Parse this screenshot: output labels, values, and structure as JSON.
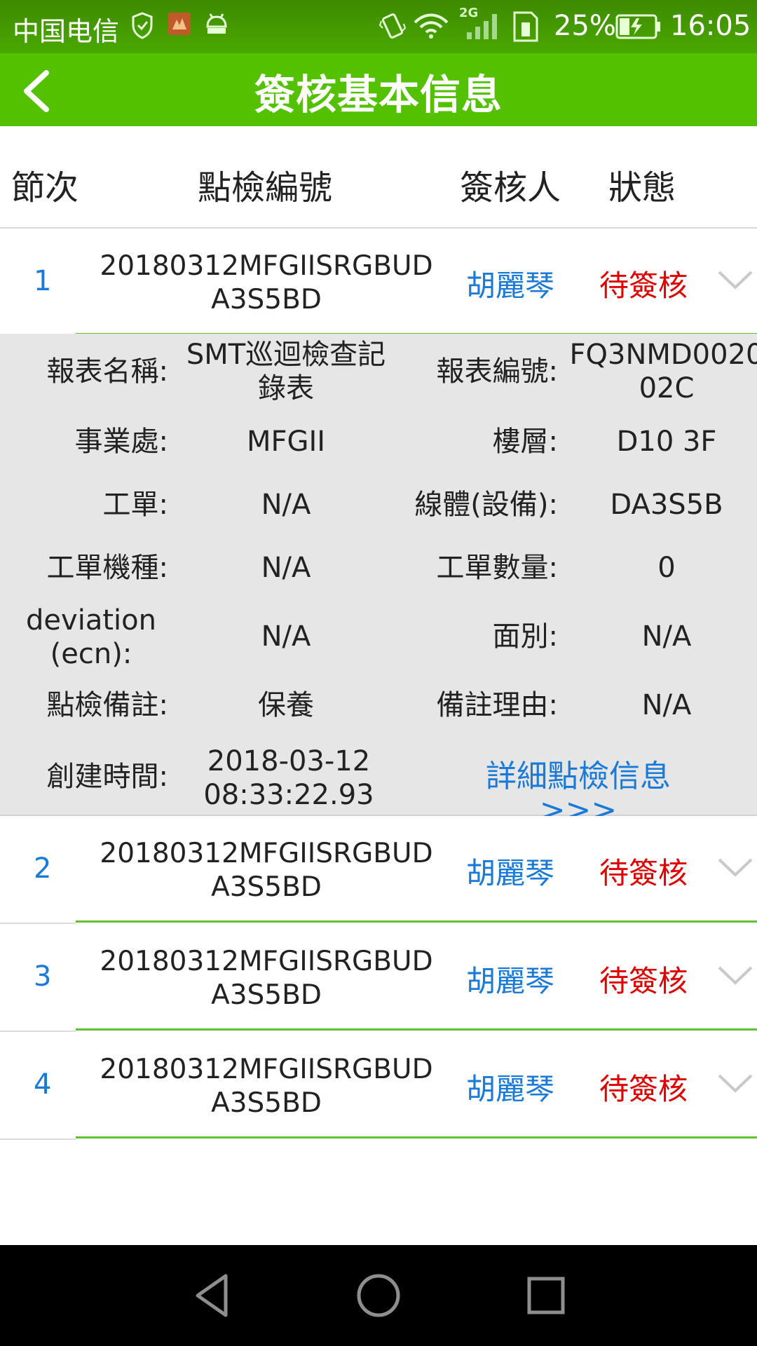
{
  "status_bar": {
    "carrier": "中国电信",
    "network_badge": "2G",
    "battery": "25%",
    "time": "16:05"
  },
  "title_bar": {
    "title": "簽核基本信息"
  },
  "columns": [
    "節次",
    "點檢編號",
    "簽核人",
    "狀態"
  ],
  "rows": [
    {
      "num": "1",
      "code": "20180312MFGIISRGBUDA3S5BD",
      "signer": "胡麗琴",
      "state": "待簽核",
      "expanded": true
    },
    {
      "num": "2",
      "code": "20180312MFGIISRGBUDA3S5BD",
      "signer": "胡麗琴",
      "state": "待簽核",
      "expanded": false
    },
    {
      "num": "3",
      "code": "20180312MFGIISRGBUDA3S5BD",
      "signer": "胡麗琴",
      "state": "待簽核",
      "expanded": false
    },
    {
      "num": "4",
      "code": "20180312MFGIISRGBUDA3S5BD",
      "signer": "胡麗琴",
      "state": "待簽核",
      "expanded": false
    }
  ],
  "detail": {
    "report_name_label": "報表名稱:",
    "report_name": "SMT巡迴檢查記錄表",
    "report_no_label": "報表編號:",
    "report_no": "FQ3NMD002002C",
    "business_label": "事業處:",
    "business": "MFGII",
    "floor_label": "樓層:",
    "floor": "D10 3F",
    "work_order_label": "工單:",
    "work_order": "N/A",
    "line_label": "線體(設備):",
    "line": "DA3S5B",
    "model_label": "工單機種:",
    "model": "N/A",
    "qty_label": "工單數量:",
    "qty": "0",
    "deviation_label": "deviation (ecn):",
    "deviation": "N/A",
    "side_label": "面別:",
    "side": "N/A",
    "remark_label": "點檢備註:",
    "remark": "保養",
    "remark_reason_label": "備註理由:",
    "remark_reason": "N/A",
    "created_label": "創建時間:",
    "created": "2018-03-12 08:33:22.93",
    "detail_link": "詳細點檢信息>>>"
  },
  "colors": {
    "title_green": "#53c000",
    "accent_blue": "#1a7ad8",
    "status_red": "#e00000",
    "divider_green": "#64c033"
  }
}
